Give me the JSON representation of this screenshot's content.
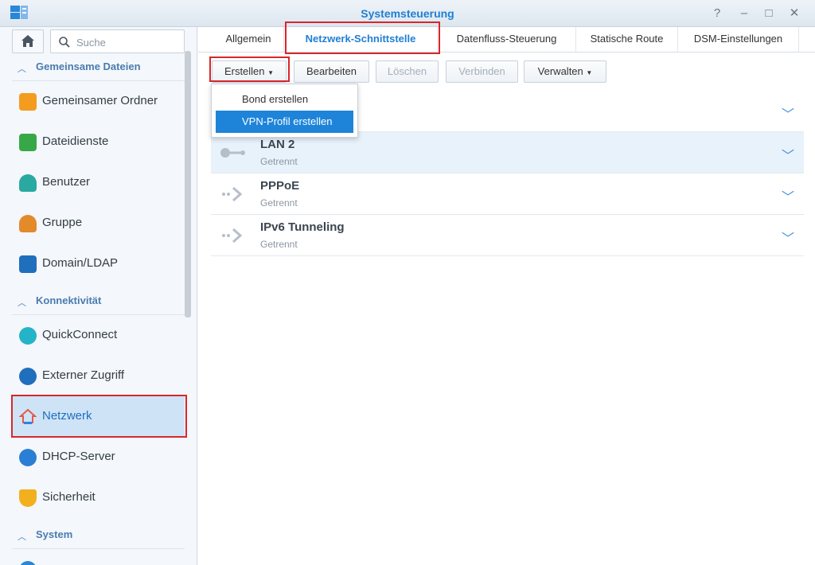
{
  "window": {
    "title": "Systemsteuerung",
    "controls": [
      "?",
      "–",
      "□",
      "✕"
    ]
  },
  "sidebar": {
    "search_placeholder": "Suche",
    "sections": [
      {
        "label": "Gemeinsame Dateien"
      },
      {
        "label": "Konnektivität"
      },
      {
        "label": "System"
      }
    ],
    "items": [
      {
        "label": "Gemeinsamer Ordner",
        "icon": "shared-folder-icon",
        "color": "#f39c1f"
      },
      {
        "label": "Dateidienste",
        "icon": "file-services-icon",
        "color": "#37a847"
      },
      {
        "label": "Benutzer",
        "icon": "user-icon",
        "color": "#2aa9a0"
      },
      {
        "label": "Gruppe",
        "icon": "group-icon",
        "color": "#e38a2a"
      },
      {
        "label": "Domain/LDAP",
        "icon": "domain-ldap-icon",
        "color": "#1f6fbd"
      },
      {
        "label": "QuickConnect",
        "icon": "quickconnect-icon",
        "color": "#25b3c7"
      },
      {
        "label": "Externer Zugriff",
        "icon": "external-access-icon",
        "color": "#1f6fbd"
      },
      {
        "label": "Netzwerk",
        "icon": "network-icon",
        "color": "#e05a4a",
        "active": true
      },
      {
        "label": "DHCP-Server",
        "icon": "dhcp-server-icon",
        "color": "#2a7fd4"
      },
      {
        "label": "Sicherheit",
        "icon": "security-icon",
        "color": "#f2b01e"
      }
    ]
  },
  "tabs": [
    {
      "label": "Allgemein"
    },
    {
      "label": "Netzwerk-Schnittstelle",
      "active": true
    },
    {
      "label": "Datenfluss-Steuerung"
    },
    {
      "label": "Statische Route"
    },
    {
      "label": "DSM-Einstellungen"
    }
  ],
  "toolbar": {
    "create": "Erstellen",
    "edit": "Bearbeiten",
    "delete": "Löschen",
    "connect": "Verbinden",
    "manage": "Verwalten"
  },
  "dropdown": {
    "items": [
      "Bond erstellen",
      "VPN-Profil erstellen"
    ],
    "highlighted_index": 1
  },
  "interfaces": [
    {
      "name": "LAN 2",
      "status": "Getrennt",
      "icon": "lan-icon"
    },
    {
      "name": "PPPoE",
      "status": "Getrennt",
      "icon": "pppoe-icon"
    },
    {
      "name": "IPv6 Tunneling",
      "status": "Getrennt",
      "icon": "ipv6-tunnel-icon"
    }
  ],
  "colors": {
    "accent": "#1f7fd4",
    "highlight_box": "#d9262c",
    "selection": "#1e84d9"
  }
}
